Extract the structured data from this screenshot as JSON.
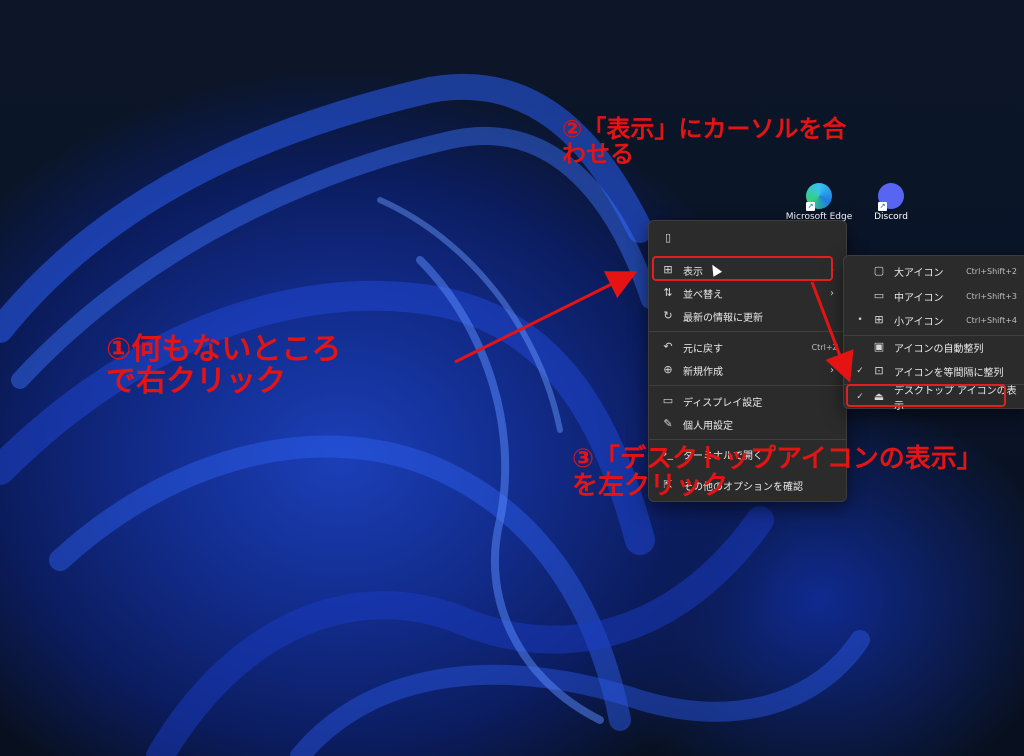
{
  "desktop": {
    "icons": [
      {
        "label": "Microsoft Edge"
      },
      {
        "label": "Discord"
      }
    ]
  },
  "context_menu": {
    "items": [
      {
        "icon": "paste-icon",
        "label": ""
      },
      {
        "icon": "grid-icon",
        "label": "表示",
        "has_submenu": true
      },
      {
        "icon": "sort-icon",
        "label": "並べ替え",
        "has_submenu": true
      },
      {
        "icon": "refresh-icon",
        "label": "最新の情報に更新"
      },
      {
        "icon": "undo-icon",
        "label": "元に戻す",
        "shortcut": "Ctrl+Z"
      },
      {
        "icon": "add-icon",
        "label": "新規作成",
        "has_submenu": true
      },
      {
        "icon": "display-icon",
        "label": "ディスプレイ設定"
      },
      {
        "icon": "brush-icon",
        "label": "個人用設定"
      },
      {
        "icon": "terminal-icon",
        "label": "ターミナルで開く"
      },
      {
        "icon": "more-icon",
        "label": "その他のオプションを確認"
      }
    ]
  },
  "view_submenu": {
    "items": [
      {
        "icon": "monitor-large-icon",
        "label": "大アイコン",
        "shortcut": "Ctrl+Shift+2",
        "mark": ""
      },
      {
        "icon": "monitor-medium-icon",
        "label": "中アイコン",
        "shortcut": "Ctrl+Shift+3",
        "mark": ""
      },
      {
        "icon": "grid-small-icon",
        "label": "小アイコン",
        "shortcut": "Ctrl+Shift+4",
        "mark": "•"
      },
      {
        "icon": "auto-arrange-icon",
        "label": "アイコンの自動整列",
        "shortcut": "",
        "mark": ""
      },
      {
        "icon": "align-grid-icon",
        "label": "アイコンを等間隔に整列",
        "shortcut": "",
        "mark": "✓"
      },
      {
        "icon": "desktop-icons-icon",
        "label": "デスクトップ アイコンの表示",
        "shortcut": "",
        "mark": "✓"
      }
    ]
  },
  "annotations": {
    "step1_line1": "①何もないところ",
    "step1_line2": "で右クリック",
    "step2_line1": "②「表示」にカーソルを合",
    "step2_line2": "わせる",
    "step3_line1": "③「デスクトップアイコンの表示」",
    "step3_line2": "を左クリック",
    "color": "#e51414"
  }
}
